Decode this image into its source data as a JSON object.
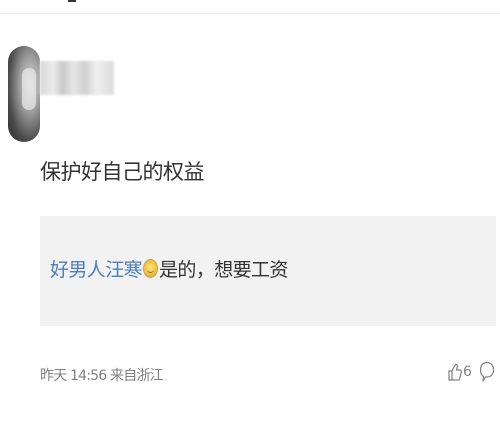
{
  "comment": {
    "author_name": "",
    "text": "保护好自己的权益",
    "time": "昨天 14:56",
    "location": "来自浙江",
    "meta_text": "昨天 14:56 来自浙江",
    "like_count": "6"
  },
  "reply": {
    "author": "好男人汪寒",
    "emoji": "smiling-emoji",
    "text": "是的，想要工资"
  },
  "icons": {
    "like": "thumbs-up-icon",
    "comment": "comment-bubble-icon"
  },
  "colors": {
    "reply_author": "#4d7fc0",
    "text": "#333333",
    "meta": "#808080",
    "reply_background": "#f2f2f2"
  }
}
